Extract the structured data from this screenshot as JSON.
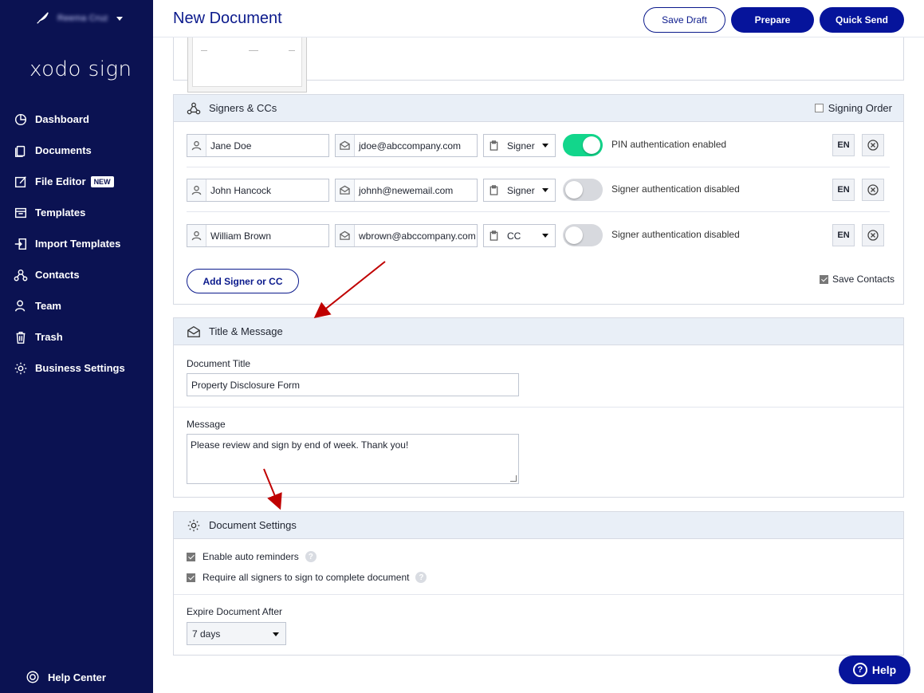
{
  "sidebar": {
    "user_name": "Reema Cruz",
    "logo": "xodo sign",
    "items": [
      {
        "label": "Dashboard",
        "icon": "pie-chart-icon"
      },
      {
        "label": "Documents",
        "icon": "documents-icon"
      },
      {
        "label": "File Editor",
        "icon": "edit-icon",
        "badge": "NEW"
      },
      {
        "label": "Templates",
        "icon": "templates-icon"
      },
      {
        "label": "Import Templates",
        "icon": "import-icon"
      },
      {
        "label": "Contacts",
        "icon": "contacts-icon"
      },
      {
        "label": "Team",
        "icon": "team-icon"
      },
      {
        "label": "Trash",
        "icon": "trash-icon"
      },
      {
        "label": "Business Settings",
        "icon": "gear-icon"
      }
    ],
    "help_center": "Help Center"
  },
  "header": {
    "title": "New Document",
    "save_draft": "Save Draft",
    "prepare": "Prepare",
    "quick_send": "Quick Send"
  },
  "signers": {
    "title": "Signers & CCs",
    "signing_order_label": "Signing Order",
    "rows": [
      {
        "name": "Jane Doe",
        "email": "jdoe@abccompany.com",
        "role": "Signer",
        "auth_on": true,
        "auth_text": "PIN authentication enabled",
        "lang": "EN"
      },
      {
        "name": "John Hancock",
        "email": "johnh@newemail.com",
        "role": "Signer",
        "auth_on": false,
        "auth_text": "Signer authentication disabled",
        "lang": "EN"
      },
      {
        "name": "William Brown",
        "email": "wbrown@abccompany.com",
        "role": "CC",
        "auth_on": false,
        "auth_text": "Signer authentication disabled",
        "lang": "EN"
      }
    ],
    "add_button": "Add Signer or CC",
    "save_contacts": "Save Contacts"
  },
  "title_message": {
    "title": "Title & Message",
    "doc_title_label": "Document Title",
    "doc_title_value": "Property Disclosure Form",
    "message_label": "Message",
    "message_value": "Please review and sign by end of week. Thank you!"
  },
  "doc_settings": {
    "title": "Document Settings",
    "auto_reminders": "Enable auto reminders",
    "require_all": "Require all signers to sign to complete document",
    "expire_label": "Expire Document After",
    "expire_value": "7 days"
  },
  "help_button": "Help",
  "colors": {
    "sidebar_bg": "#0b1252",
    "accent": "#06149b",
    "toggle_on": "#12d68b",
    "arrow": "#c00000"
  }
}
